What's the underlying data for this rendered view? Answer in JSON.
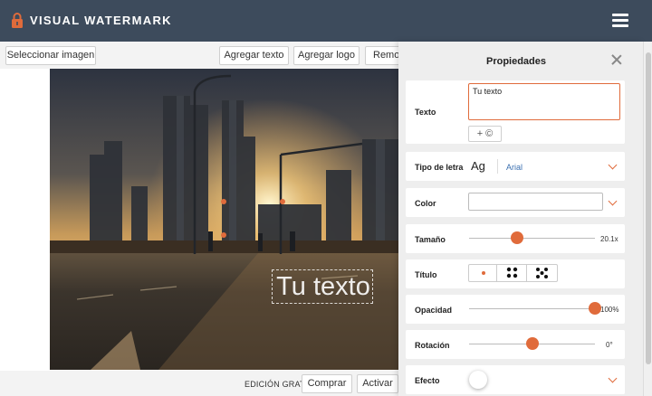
{
  "header": {
    "brand": "VISUAL WATERMARK",
    "logo_icon": "lock-icon",
    "menu_icon": "hamburger-menu-icon"
  },
  "toolbar": {
    "select_image": "Seleccionar imagen",
    "add_text": "Agregar texto",
    "add_logo": "Agregar logo",
    "remove": "Remov"
  },
  "canvas": {
    "watermark_text": "Tu texto"
  },
  "bottom": {
    "free_edition": "EDICIÓN GRATIS",
    "buy": "Comprar",
    "activate": "Activar"
  },
  "panel": {
    "title": "Propiedades",
    "text": {
      "label": "Texto",
      "value": "Tu texto",
      "symbol_button": "+ ©"
    },
    "font": {
      "label": "Tipo de letra",
      "preview": "Ag",
      "value": "Arial"
    },
    "color": {
      "label": "Color",
      "value": ""
    },
    "size": {
      "label": "Tamaño",
      "value": "20.1x",
      "level": 0.38
    },
    "title_mode": {
      "label": "Título",
      "options": [
        "single-dot",
        "four-dots",
        "five-dots"
      ],
      "selected": 0
    },
    "opacity": {
      "label": "Opacidad",
      "value": "100%",
      "level": 1.0
    },
    "rotation": {
      "label": "Rotación",
      "value": "0°",
      "level": 0.5
    },
    "effect": {
      "label": "Efecto",
      "enabled": false
    }
  },
  "colors": {
    "accent": "#e06b3b",
    "header": "#3d4b5c"
  }
}
